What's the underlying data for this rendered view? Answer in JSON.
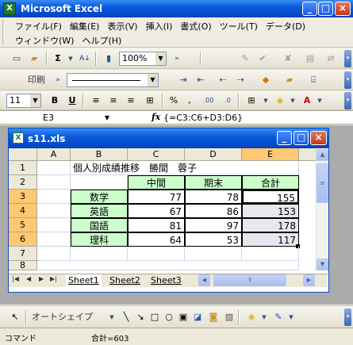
{
  "app": {
    "title": "Microsoft Excel"
  },
  "menu": {
    "row1": [
      "ファイル(F)",
      "編集(E)",
      "表示(V)",
      "挿入(I)",
      "書式(O)",
      "ツール(T)",
      "データ(D)"
    ],
    "row2": [
      "ウィンドウ(W)",
      "ヘルプ(H)"
    ]
  },
  "toolbar1": {
    "zoom": "100%"
  },
  "toolbar2": {
    "print_label": "印刷"
  },
  "toolbar3": {
    "font_size": "11"
  },
  "formula_bar": {
    "cell_ref": "E3",
    "fx": "fx",
    "formula": "{=C3:C6+D3:D6}"
  },
  "workbook": {
    "title": "s11.xls"
  },
  "sheet": {
    "columns": [
      "A",
      "B",
      "C",
      "D",
      "E"
    ],
    "rows": [
      "1",
      "2",
      "3",
      "4",
      "5",
      "6",
      "7",
      "8"
    ],
    "title_cell": "個人別成績推移　勝間　蓉子",
    "headers": [
      "中間",
      "期末",
      "合計"
    ],
    "data": [
      {
        "subject": "数学",
        "mid": "77",
        "final": "78",
        "total": "155"
      },
      {
        "subject": "英語",
        "mid": "67",
        "final": "86",
        "total": "153"
      },
      {
        "subject": "国語",
        "mid": "81",
        "final": "97",
        "total": "178"
      },
      {
        "subject": "理科",
        "mid": "64",
        "final": "53",
        "total": "117"
      }
    ]
  },
  "tabs": [
    "Sheet1",
    "Sheet2",
    "Sheet3"
  ],
  "drawbar": {
    "autoshape_label": "オートシェイプ(U)"
  },
  "status": {
    "mode": "コマンド",
    "sum": "合計=603"
  },
  "colors": {
    "selection": "#FFC873",
    "header_fill": "#CCFFCC",
    "title_bar": "#0A5BDB"
  }
}
